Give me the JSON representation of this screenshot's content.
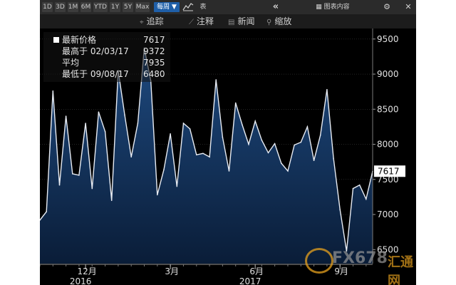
{
  "toolbar": {
    "ranges": [
      "1D",
      "3D",
      "1M",
      "6M",
      "YTD",
      "1Y",
      "5Y",
      "Max"
    ],
    "frequency": "每周 ▼",
    "table_label": "表",
    "chart_contents": "图表内容",
    "collapse_icon": "«",
    "gear_icon": "⚙",
    "close_icon": "✕"
  },
  "toolbar2": {
    "track": "追踪",
    "annotate": "注释",
    "news": "新闻",
    "zoom": "缩放",
    "track_icon": "⌖",
    "annotate_icon": "⟋",
    "news_icon": "▤",
    "zoom_icon": "⚲"
  },
  "legend": {
    "rows": [
      {
        "label": "最新价格",
        "value": "7617"
      },
      {
        "label": "最高于 02/03/17",
        "value": "9372"
      },
      {
        "label": "平均",
        "value": "7935"
      },
      {
        "label": "最低于 09/08/17",
        "value": "6480"
      }
    ]
  },
  "watermark": {
    "text": "FX678",
    "sub": "汇通网"
  },
  "colors": {
    "line": "#e8ecf3",
    "fill_top": "#1e4a80",
    "fill_bottom": "#0a1d38",
    "bg": "#000000"
  },
  "chart_data": {
    "type": "area",
    "y_ticks": [
      6500,
      7000,
      7500,
      8000,
      8500,
      9000,
      9500
    ],
    "ylim": [
      6300,
      9650
    ],
    "x_ticks": [
      {
        "label": "12月",
        "year": "2016",
        "index": 7
      },
      {
        "label": "3月",
        "index": 20
      },
      {
        "label": "6月",
        "year": "2017",
        "index": 33
      },
      {
        "label": "9月",
        "index": 46
      }
    ],
    "last_value_label": "7617",
    "values": [
      6920,
      7040,
      8760,
      7420,
      8400,
      7580,
      7560,
      8300,
      7370,
      8460,
      8180,
      7200,
      9050,
      8420,
      7820,
      8300,
      9372,
      8900,
      7280,
      7640,
      8150,
      7400,
      8300,
      8220,
      7850,
      7870,
      7820,
      8920,
      8100,
      7620,
      8590,
      8280,
      8000,
      8330,
      8060,
      7880,
      8010,
      7730,
      7620,
      7990,
      8030,
      8250,
      7770,
      8130,
      8780,
      7800,
      7070,
      6480,
      7370,
      7420,
      7220,
      7617
    ]
  }
}
